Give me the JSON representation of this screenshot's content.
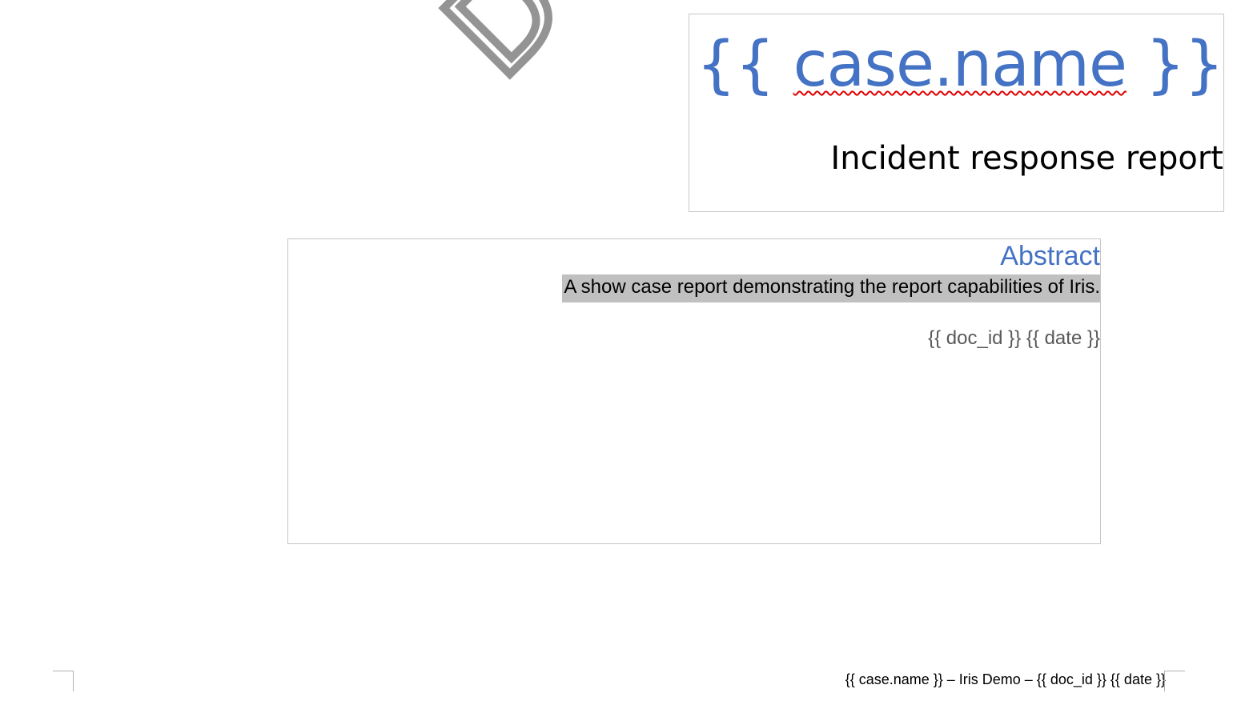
{
  "title_block": {
    "case_name_open": "{{ ",
    "case_name_var": "case.name",
    "case_name_close": " }}",
    "report_title": "Incident response report"
  },
  "abstract": {
    "heading": "Abstract",
    "text": "A show case report demonstrating the report capabilities of Iris.",
    "doc_meta": "{{ doc_id }} {{ date }}"
  },
  "footer": {
    "text": "{{ case.name }} – Iris Demo – {{ doc_id }} {{ date }}"
  },
  "colors": {
    "accent": "#4472c4",
    "highlight": "#c0c0c0",
    "meta_text": "#595959",
    "spellcheck": "#e00000"
  }
}
